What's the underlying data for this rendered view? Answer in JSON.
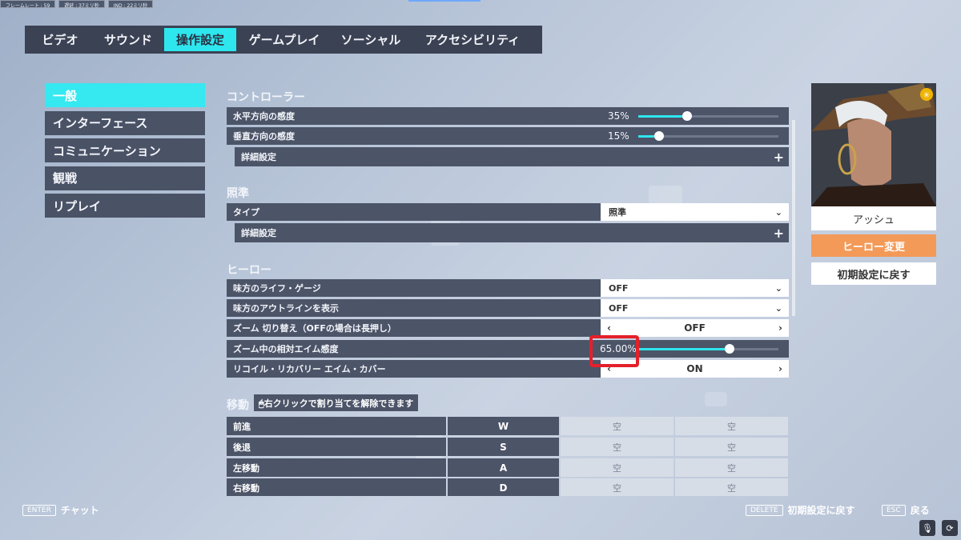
{
  "perf": {
    "framerate": "フレームレート : 59",
    "latency": "遅延 : 37ミリ秒",
    "ind": "IND : 22ミリ秒"
  },
  "tabs": [
    {
      "label": "ビデオ",
      "active": false
    },
    {
      "label": "サウンド",
      "active": false
    },
    {
      "label": "操作設定",
      "active": true
    },
    {
      "label": "ゲームプレイ",
      "active": false
    },
    {
      "label": "ソーシャル",
      "active": false
    },
    {
      "label": "アクセシビリティ",
      "active": false
    }
  ],
  "sidebar": {
    "items": [
      {
        "label": "一般",
        "active": true
      },
      {
        "label": "インターフェース",
        "active": false
      },
      {
        "label": "コミュニケーション",
        "active": false
      },
      {
        "label": "観戦",
        "active": false
      },
      {
        "label": "リプレイ",
        "active": false
      }
    ]
  },
  "controller": {
    "title": "コントローラー",
    "horizontal_label": "水平方向の感度",
    "horizontal_value": "35%",
    "horizontal_level": 0.35,
    "vertical_label": "垂直方向の感度",
    "vertical_value": "15%",
    "vertical_level": 0.15,
    "advanced_label": "詳細設定"
  },
  "aim": {
    "title": "照準",
    "type_label": "タイプ",
    "type_value": "照準",
    "advanced_label": "詳細設定"
  },
  "hero_settings": {
    "title": "ヒーロー",
    "ally_health_label": "味方のライフ・ゲージ",
    "ally_health_value": "OFF",
    "ally_outline_label": "味方のアウトラインを表示",
    "ally_outline_value": "OFF",
    "zoom_toggle_label": "ズーム 切り替え（OFFの場合は長押し）",
    "zoom_toggle_value": "OFF",
    "zoom_sens_label": "ズーム中の相対エイム感度",
    "zoom_sens_value": "65.00%",
    "zoom_sens_level": 0.65,
    "recoil_label": "リコイル・リカバリー エイム・カバー",
    "recoil_value": "ON"
  },
  "movement": {
    "title": "移動",
    "hint": "右クリックで割り当てを解除できます",
    "rows": [
      {
        "label": "前進",
        "key": "W",
        "alt1": "空",
        "alt2": "空"
      },
      {
        "label": "後退",
        "key": "S",
        "alt1": "空",
        "alt2": "空"
      },
      {
        "label": "左移動",
        "key": "A",
        "alt1": "空",
        "alt2": "空"
      },
      {
        "label": "右移動",
        "key": "D",
        "alt1": "空",
        "alt2": "空"
      }
    ]
  },
  "hero_panel": {
    "name": "アッシュ",
    "change_label": "ヒーロー変更",
    "reset_label": "初期設定に戻す"
  },
  "footer": {
    "enter_key": "ENTER",
    "enter_label": "チャット",
    "delete_key": "DELETE",
    "delete_label": "初期設定に戻す",
    "esc_key": "ESC",
    "esc_label": "戻る"
  },
  "colors": {
    "accent": "#2ee6ee",
    "hero_button": "#f39a58",
    "highlight_box": "#e4202a"
  }
}
